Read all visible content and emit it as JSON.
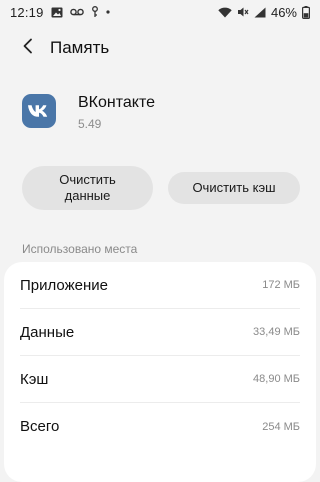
{
  "status_bar": {
    "time": "12:19",
    "battery_percent": "46%",
    "left_icons": [
      "image-icon",
      "voicemail-icon",
      "key-icon",
      "dot-icon"
    ],
    "right_icons": [
      "wifi-icon",
      "mute-icon",
      "signal-icon",
      "battery-icon"
    ]
  },
  "header": {
    "title": "Память",
    "back_icon": "chevron-left-icon"
  },
  "app": {
    "name": "ВКонтакте",
    "version": "5.49",
    "icon_text": "VK",
    "icon_color": "#4a76a8"
  },
  "actions": {
    "clear_data": "Очистить данные",
    "clear_cache": "Очистить кэш"
  },
  "storage": {
    "section_label": "Использовано места",
    "rows": [
      {
        "label": "Приложение",
        "value": "172 МБ"
      },
      {
        "label": "Данные",
        "value": "33,49 МБ"
      },
      {
        "label": "Кэш",
        "value": "48,90 МБ"
      },
      {
        "label": "Всего",
        "value": "254 МБ"
      }
    ]
  }
}
